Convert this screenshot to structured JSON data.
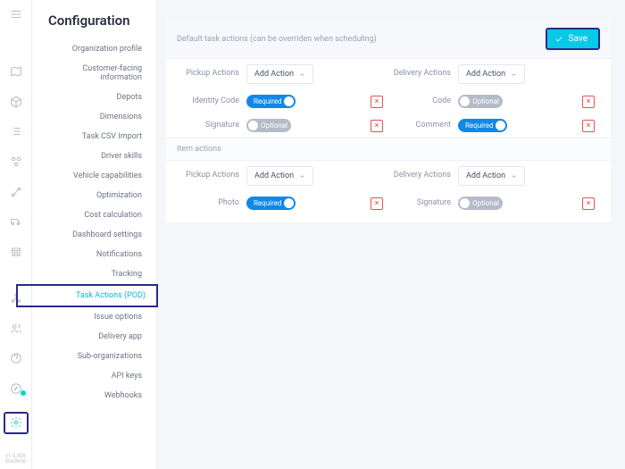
{
  "page": {
    "title": "Configuration"
  },
  "nav": {
    "items": [
      {
        "label": "Organization profile"
      },
      {
        "label": "Customer-facing information"
      },
      {
        "label": "Depots"
      },
      {
        "label": "Dimensions"
      },
      {
        "label": "Task CSV Import"
      },
      {
        "label": "Driver skills"
      },
      {
        "label": "Vehicle capabilities"
      },
      {
        "label": "Optimization"
      },
      {
        "label": "Cost calculation"
      },
      {
        "label": "Dashboard settings"
      },
      {
        "label": "Notifications"
      },
      {
        "label": "Tracking"
      },
      {
        "label": "Task Actions (POD)"
      },
      {
        "label": "Issue options"
      },
      {
        "label": "Delivery app"
      },
      {
        "label": "Sub-organizations"
      },
      {
        "label": "API keys"
      },
      {
        "label": "Webhooks"
      }
    ]
  },
  "panel": {
    "default_head": "Default task actions (can be overriden when scheduling)",
    "item_head": "Item actions",
    "save": "Save",
    "pickup_label": "Pickup Actions",
    "delivery_label": "Delivery Actions",
    "add_action": "Add Action",
    "rows1_left": [
      {
        "label": "Identity Code",
        "state": "Required"
      },
      {
        "label": "Signature",
        "state": "Optional"
      }
    ],
    "rows1_right": [
      {
        "label": "Code",
        "state": "Optional"
      },
      {
        "label": "Comment",
        "state": "Required"
      }
    ],
    "rows2_left": [
      {
        "label": "Photo",
        "state": "Required"
      }
    ],
    "rows2_right": [
      {
        "label": "Signature",
        "state": "Optional"
      }
    ]
  },
  "version": {
    "line1": "v1.0.406",
    "line2": "00e9656"
  }
}
